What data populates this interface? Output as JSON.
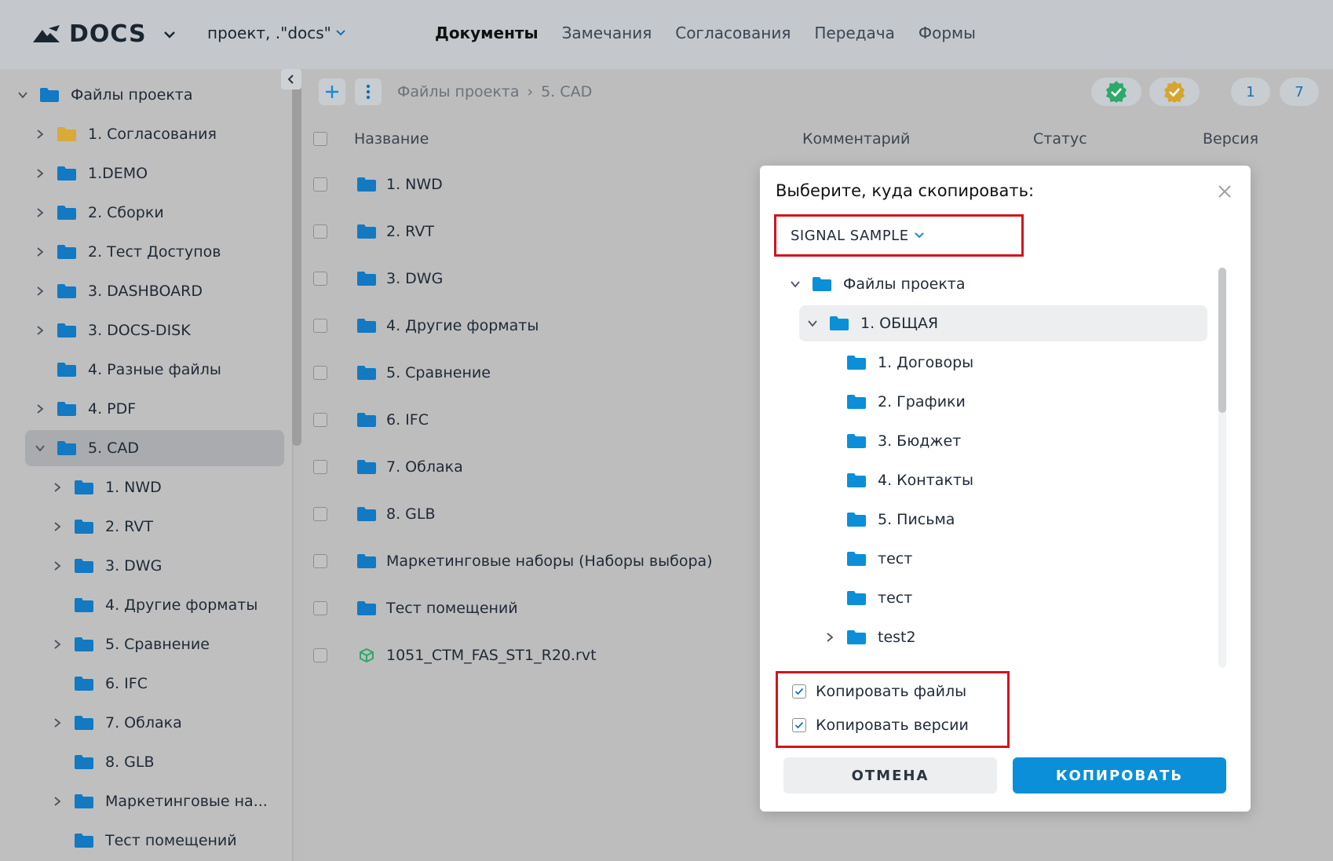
{
  "header": {
    "logo_text": "DOCS",
    "project_selector": "проект, .\"docs\"",
    "nav": [
      "Документы",
      "Замечания",
      "Согласования",
      "Передача",
      "Формы"
    ],
    "active_nav": "Документы"
  },
  "sidebar": {
    "root": "Файлы проекта",
    "items": [
      {
        "label": "1. Согласования",
        "folder_color": "#d9a93a",
        "has_caret": true
      },
      {
        "label": "1.DEMO",
        "has_caret": true
      },
      {
        "label": "2. Сборки",
        "has_caret": true
      },
      {
        "label": "2. Тест Доступов",
        "has_caret": true
      },
      {
        "label": "3. DASHBOARD",
        "has_caret": true
      },
      {
        "label": "3. DOCS-DISK",
        "has_caret": true
      },
      {
        "label": "4. Разные файлы",
        "has_caret": false
      },
      {
        "label": "4. PDF",
        "has_caret": true
      },
      {
        "label": "5. CAD",
        "has_caret": true,
        "expanded": true,
        "selected": true
      }
    ],
    "sub_items": [
      {
        "label": "1. NWD",
        "has_caret": true
      },
      {
        "label": "2. RVT",
        "has_caret": true
      },
      {
        "label": "3. DWG",
        "has_caret": true
      },
      {
        "label": "4. Другие форматы",
        "has_caret": false
      },
      {
        "label": "5. Сравнение",
        "has_caret": true
      },
      {
        "label": "6. IFC",
        "has_caret": false
      },
      {
        "label": "7. Облака",
        "has_caret": true
      },
      {
        "label": "8. GLB",
        "has_caret": false
      },
      {
        "label": "Маркетинговые на...",
        "has_caret": true
      },
      {
        "label": "Тест помещений",
        "has_caret": false
      }
    ]
  },
  "toolbar": {
    "breadcrumb": [
      "Файлы проекта",
      "5. CAD"
    ],
    "count_left": "1",
    "count_right": "7",
    "badge_green_color": "#2fa86b",
    "badge_yellow_color": "#d6a531"
  },
  "table": {
    "columns": [
      "Название",
      "Комментарий",
      "Статус",
      "Версия"
    ],
    "rows": [
      {
        "name": "1. NWD",
        "type": "folder"
      },
      {
        "name": "2. RVT",
        "type": "folder"
      },
      {
        "name": "3. DWG",
        "type": "folder"
      },
      {
        "name": "4. Другие форматы",
        "type": "folder"
      },
      {
        "name": "5. Сравнение",
        "type": "folder"
      },
      {
        "name": "6. IFC",
        "type": "folder"
      },
      {
        "name": "7. Облака",
        "type": "folder"
      },
      {
        "name": "8. GLB",
        "type": "folder"
      },
      {
        "name": "Маркетинговые наборы (Наборы выбора)",
        "type": "folder"
      },
      {
        "name": "Тест помещений",
        "type": "folder"
      },
      {
        "name": "1051_CTM_FAS_ST1_R20.rvt",
        "type": "model"
      }
    ]
  },
  "modal": {
    "title": "Выберите, куда скопировать:",
    "project": "SIGNAL SAMPLE",
    "tree": [
      {
        "label": "Файлы проекта",
        "level": 0,
        "caret": "down"
      },
      {
        "label": "1. ОБЩАЯ",
        "level": 1,
        "caret": "down",
        "selected": true
      },
      {
        "label": "1. Договоры",
        "level": 2,
        "caret": ""
      },
      {
        "label": "2. Графики",
        "level": 2,
        "caret": ""
      },
      {
        "label": "3. Бюджет",
        "level": 2,
        "caret": ""
      },
      {
        "label": "4. Контакты",
        "level": 2,
        "caret": ""
      },
      {
        "label": "5. Письма",
        "level": 2,
        "caret": ""
      },
      {
        "label": "тест",
        "level": 2,
        "caret": ""
      },
      {
        "label": "тест",
        "level": 2,
        "caret": ""
      },
      {
        "label": "test2",
        "level": 2,
        "caret": "right"
      }
    ],
    "copy_files_label": "Копировать файлы",
    "copy_files_checked": true,
    "copy_versions_label": "Копировать версии",
    "copy_versions_checked": true,
    "cancel_label": "ОТМЕНА",
    "copy_label": "КОПИРОВАТЬ",
    "accent_color": "#0a8fd8",
    "highlight_color": "#d4141c"
  }
}
